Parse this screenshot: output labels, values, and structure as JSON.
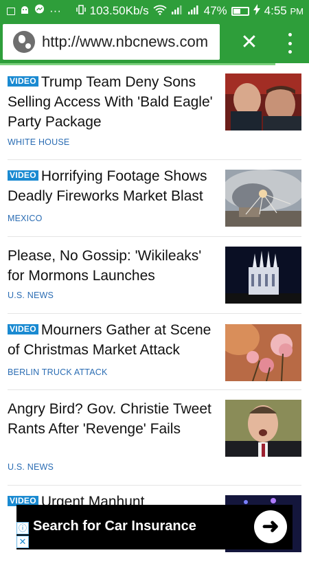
{
  "status_bar": {
    "network_speed": "103.50Kb/s",
    "battery_percent": "47%",
    "time": "4:55",
    "ampm": "PM"
  },
  "browser": {
    "url": "http://www.nbcnews.com",
    "close_glyph": "✕",
    "page_load_progress": 0.89
  },
  "stories": [
    {
      "badge": "VIDEO",
      "title": "Trump Team Deny Sons Selling Access With 'Bald Eagle' Party Package",
      "section": "WHITE HOUSE",
      "thumb": "two-men-photo"
    },
    {
      "badge": "VIDEO",
      "title": "Horrifying Footage Shows Deadly Fireworks Market Blast",
      "section": "MEXICO",
      "thumb": "explosion-photo"
    },
    {
      "badge": "",
      "title": "Please, No Gossip: 'Wikileaks' for Mormons Launches",
      "section": "U.S. NEWS",
      "thumb": "temple-night-photo"
    },
    {
      "badge": "VIDEO",
      "title": "Mourners Gather at Scene of Christmas Market Attack",
      "section": "BERLIN TRUCK ATTACK",
      "thumb": "flowers-photo"
    },
    {
      "badge": "",
      "title": "Angry Bird? Gov. Christie Tweet Rants After 'Revenge' Fails",
      "section": "U.S. NEWS",
      "thumb": "man-speaking-photo"
    },
    {
      "badge": "VIDEO",
      "title": "Urgent Manhunt",
      "section": "",
      "thumb": "dark-blue-photo"
    }
  ],
  "ad": {
    "text": "Search for Car Insurance",
    "arrow_glyph": "➜",
    "info_glyph": "ⓘ",
    "close_glyph": "✕"
  }
}
